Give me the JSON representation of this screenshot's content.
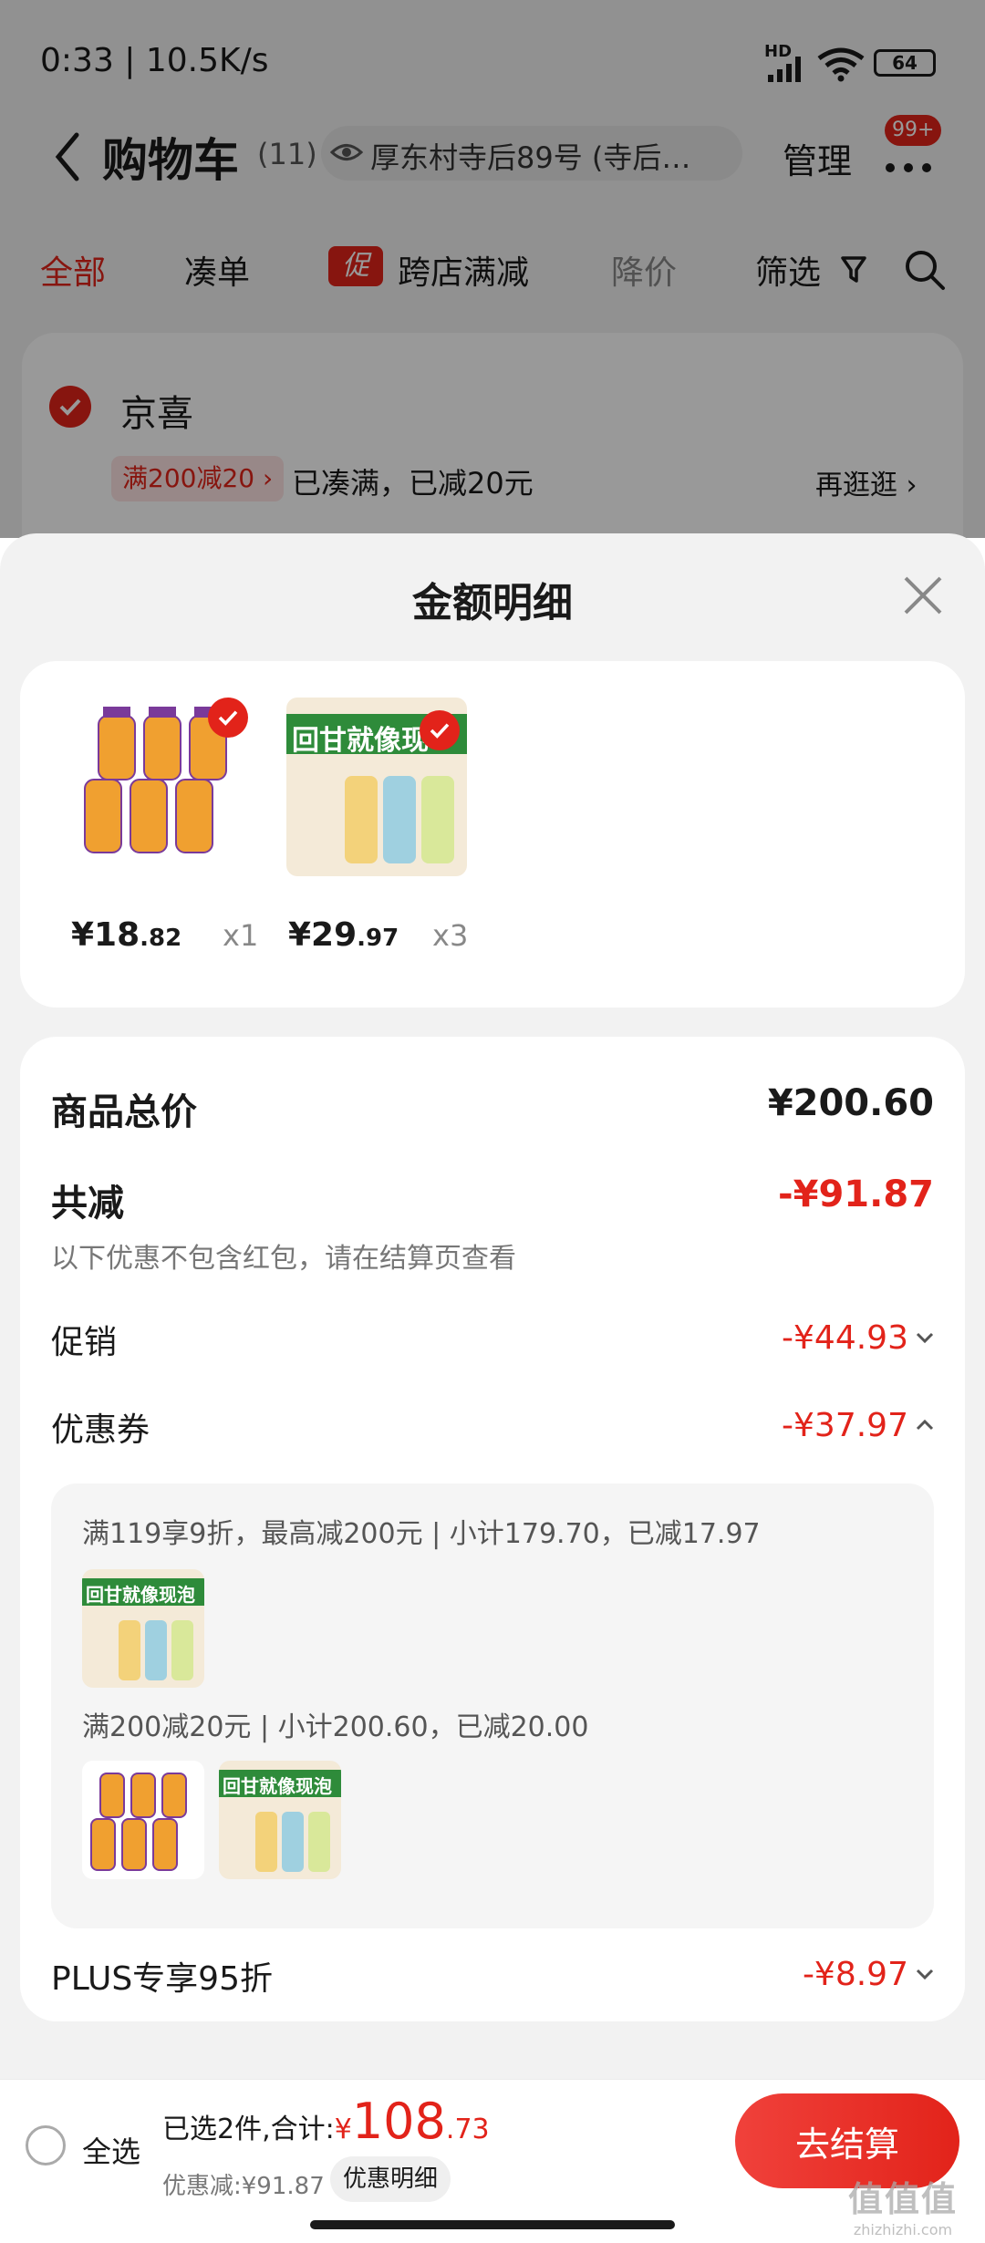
{
  "status_bar": {
    "time_speed": "0:33 | 10.5K/s",
    "network": "HD",
    "battery": "64"
  },
  "header": {
    "title": "购物车",
    "count": "(11)",
    "address": "厚东村寺后89号 (寺后…",
    "manage": "管理",
    "badge": "99+"
  },
  "tabs": [
    {
      "label": "全部"
    },
    {
      "label": "凑单"
    },
    {
      "label": "跨店满减",
      "tag": "促"
    },
    {
      "label": "降价"
    },
    {
      "label": "筛选"
    }
  ],
  "shop": {
    "name": "京喜",
    "promo_tag": "满200减20 ›",
    "promo_text": "已凑满，已减20元",
    "more": "再逛逛 ›"
  },
  "sheet": {
    "title": "金额明细",
    "items": [
      {
        "price_main": "¥18",
        "price_dec": ".82",
        "qty": "x1"
      },
      {
        "price_main": "¥29",
        "price_dec": ".97",
        "qty": "x3",
        "image_text": "回甘就像现泡"
      }
    ],
    "summary": {
      "total_label": "商品总价",
      "total_value": "¥200.60",
      "reduce_label": "共减",
      "reduce_value": "-¥91.87",
      "note": "以下优惠不包含红包，请在结算页查看",
      "promo_label": "促销",
      "promo_value": "-¥44.93",
      "coupon_label": "优惠券",
      "coupon_value": "-¥37.97",
      "coupons": [
        {
          "desc": "满119享9折，最高减200元 | 小计179.70，已减17.97",
          "image_text": "回甘就像现泡"
        },
        {
          "desc": "满200减20元 | 小计200.60，已减20.00",
          "image_text": "回甘就像现泡"
        }
      ],
      "plus_label": "PLUS专享95折",
      "plus_value": "-¥8.97"
    }
  },
  "bottom": {
    "select_all": "全选",
    "selected_text": "已选2件,合计:",
    "currency": "¥",
    "total_main": "108",
    "total_dec": ".73",
    "discount": "优惠减:¥91.87",
    "detail_btn": "优惠明细",
    "checkout": "去结算"
  },
  "watermark": {
    "logo": "值值值",
    "url": "zhizhizhi.com"
  },
  "colors": {
    "accent": "#e2231a",
    "sheet_bg": "#f2f2f2"
  }
}
